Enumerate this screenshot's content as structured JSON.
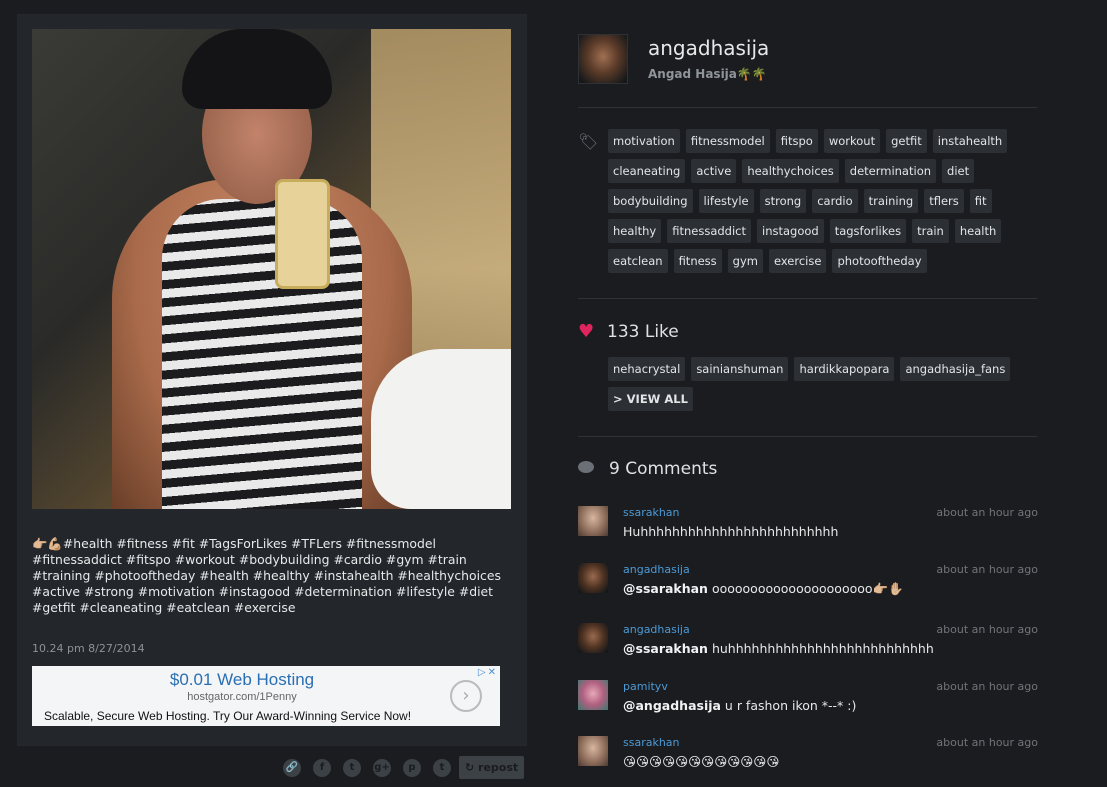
{
  "post": {
    "caption": "👉🏼💪🏼#health #fitness #fit #TagsForLikes #TFLers #fitnessmodel #fitnessaddict #fitspo #workout #bodybuilding #cardio #gym #train #training #photooftheday #health #healthy #instahealth #healthychoices #active #strong #motivation #instagood #determination #lifestyle #diet #getfit #cleaneating #eatclean #exercise",
    "timestamp": "10.24 pm 8/27/2014"
  },
  "ad": {
    "title": "$0.01 Web Hosting",
    "url": "hostgator.com/1Penny",
    "description": "Scalable, Secure Web Hosting. Try Our Award-Winning Service Now!",
    "arrow": "›",
    "badge": "▷✕"
  },
  "share": {
    "icons": [
      "link-icon",
      "facebook-icon",
      "twitter-icon",
      "google-plus-icon",
      "pinterest-icon",
      "tumblr-icon"
    ],
    "glyphs": [
      "🔗",
      "f",
      "t",
      "g+",
      "p",
      "t"
    ],
    "repost_label": "↻ repost"
  },
  "profile": {
    "username": "angadhasija",
    "full_name": "Angad Hasija🌴🌴"
  },
  "tags": [
    "motivation",
    "fitnessmodel",
    "fitspo",
    "workout",
    "getfit",
    "instahealth",
    "cleaneating",
    "active",
    "healthychoices",
    "determination",
    "diet",
    "bodybuilding",
    "lifestyle",
    "strong",
    "cardio",
    "training",
    "tflers",
    "fit",
    "healthy",
    "fitnessaddict",
    "instagood",
    "tagsforlikes",
    "train",
    "health",
    "eatclean",
    "fitness",
    "gym",
    "exercise",
    "photooftheday"
  ],
  "likes": {
    "title": "133 Like",
    "users": [
      "nehacrystal",
      "sainianshuman",
      "hardikkapopara",
      "angadhasija_fans"
    ],
    "view_all": "> VIEW ALL"
  },
  "comments": {
    "title": "9 Comments",
    "items": [
      {
        "user": "ssarakhan",
        "time": "about an hour ago",
        "mention": "",
        "text": "Huhhhhhhhhhhhhhhhhhhhhhhhhh"
      },
      {
        "user": "angadhasija",
        "time": "about an hour ago",
        "mention": "@ssarakhan",
        "text": " ooooooooooooooooooooo👉🏼✋🏼"
      },
      {
        "user": "angadhasija",
        "time": "about an hour ago",
        "mention": "@ssarakhan",
        "text": " huhhhhhhhhhhhhhhhhhhhhhhhhhh"
      },
      {
        "user": "pamityv",
        "time": "about an hour ago",
        "mention": "@angadhasija",
        "text": " u r fashon ikon *--* :)"
      },
      {
        "user": "ssarakhan",
        "time": "about an hour ago",
        "mention": "",
        "text": "😘😘😘😘😘😘😘😘😘😘😘😘"
      }
    ]
  },
  "colors": {
    "accent": "#4d9ad6",
    "heart": "#e0245e",
    "background": "#1a1c1f",
    "card": "#23272b"
  }
}
